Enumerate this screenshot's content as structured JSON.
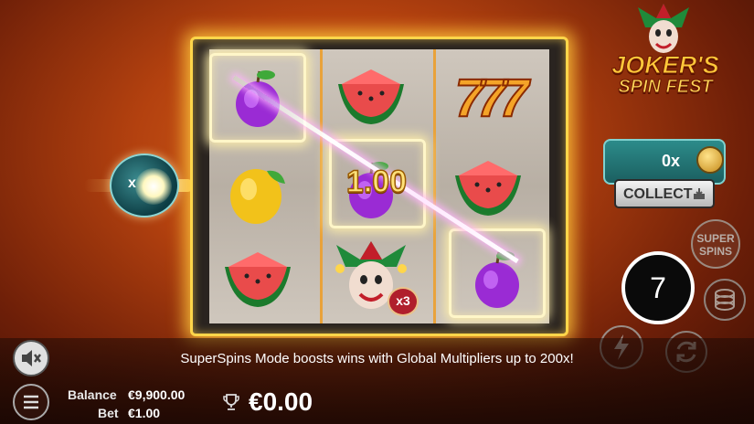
{
  "logo": {
    "line1": "JOKER'S",
    "line2": "SPIN FEST"
  },
  "collect": {
    "value": "0x",
    "button_label": "COLLECT"
  },
  "super_spins": {
    "line1": "SUPER",
    "line2": "SPINS"
  },
  "spin": {
    "counter": "7"
  },
  "multiplier": {
    "value": "1.00"
  },
  "left_orb": {
    "label": "x"
  },
  "reels": [
    [
      "plum",
      "lemon",
      "watermelon"
    ],
    [
      "watermelon",
      "plum",
      "joker"
    ],
    [
      "seven",
      "watermelon",
      "plum"
    ]
  ],
  "joker_badge": "x3",
  "message": "SuperSpins Mode boosts wins with Global Multipliers up to 200x!",
  "balance": {
    "label": "Balance",
    "value": "€9,900.00"
  },
  "bet": {
    "label": "Bet",
    "value": "€1.00"
  },
  "win": {
    "value": "€0.00"
  },
  "colors": {
    "accent": "#ffd64a",
    "teal": "#2c8b8a",
    "background": "#b3410f"
  }
}
